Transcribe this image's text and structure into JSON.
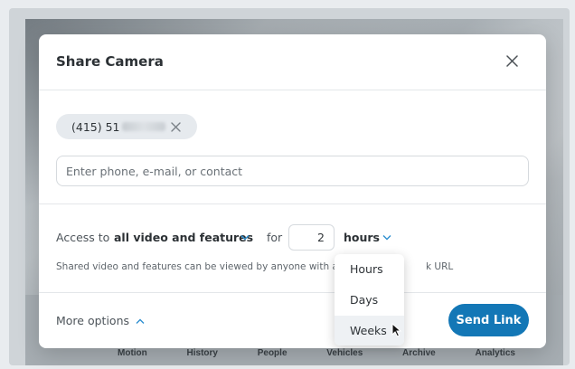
{
  "bottom_nav": [
    "Motion",
    "History",
    "People",
    "Vehicles",
    "Archive",
    "Analytics"
  ],
  "modal": {
    "title": "Share Camera",
    "close_icon": "close-icon"
  },
  "recipient_chip": {
    "visible_text": "(415) 51",
    "remove_icon": "close-icon"
  },
  "contact_input": {
    "placeholder": "Enter phone, e-mail, or contact",
    "value": ""
  },
  "access": {
    "label": "Access to",
    "scope": "all video and features",
    "for_label": "for",
    "duration": "2",
    "unit": "hours"
  },
  "helper_text": {
    "visible_start": "Shared video and features can be viewed by anyone with a",
    "visible_end": "k URL"
  },
  "more_options": "More options",
  "send_button": "Send Link",
  "unit_dropdown": {
    "options": [
      "Hours",
      "Days",
      "Weeks"
    ],
    "hovered": "Weeks"
  },
  "colors": {
    "accent": "#1377b6",
    "chevron": "#2e8fd0"
  }
}
